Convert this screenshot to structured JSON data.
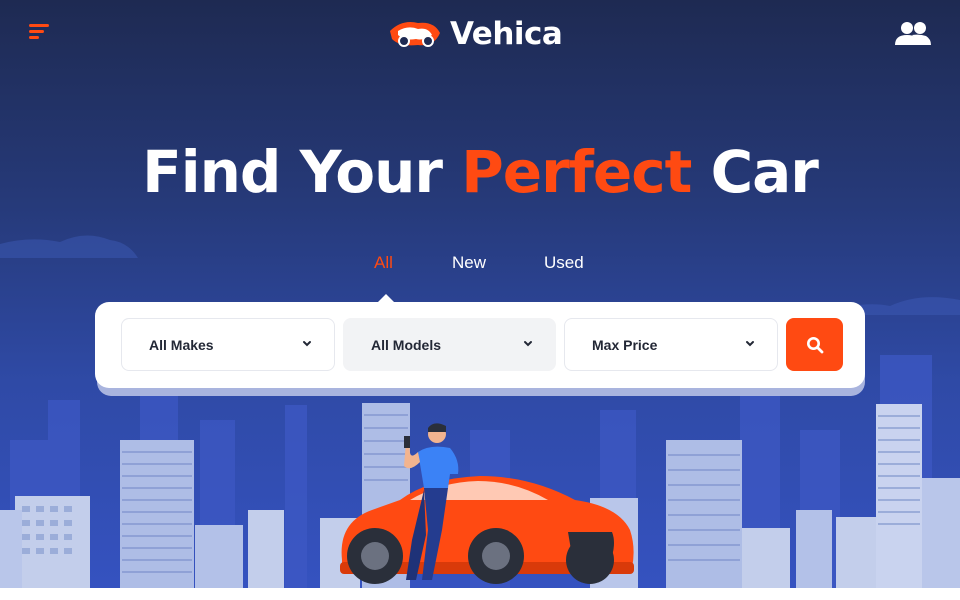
{
  "header": {
    "brand": "Vehica",
    "menu_icon": "menu-icon",
    "users_icon": "users-icon"
  },
  "hero": {
    "headline_part1": "Find Your ",
    "headline_accent": "Perfect",
    "headline_part2": " Car"
  },
  "tabs": [
    {
      "label": "All",
      "active": true
    },
    {
      "label": "New",
      "active": false
    },
    {
      "label": "Used",
      "active": false
    }
  ],
  "search": {
    "makes": "All Makes",
    "models": "All Models",
    "price": "Max Price",
    "button_icon": "search-icon"
  },
  "colors": {
    "accent": "#ff4a12",
    "hero_top": "#1e2a52",
    "hero_bottom": "#3552c0",
    "text_dark": "#232836"
  }
}
